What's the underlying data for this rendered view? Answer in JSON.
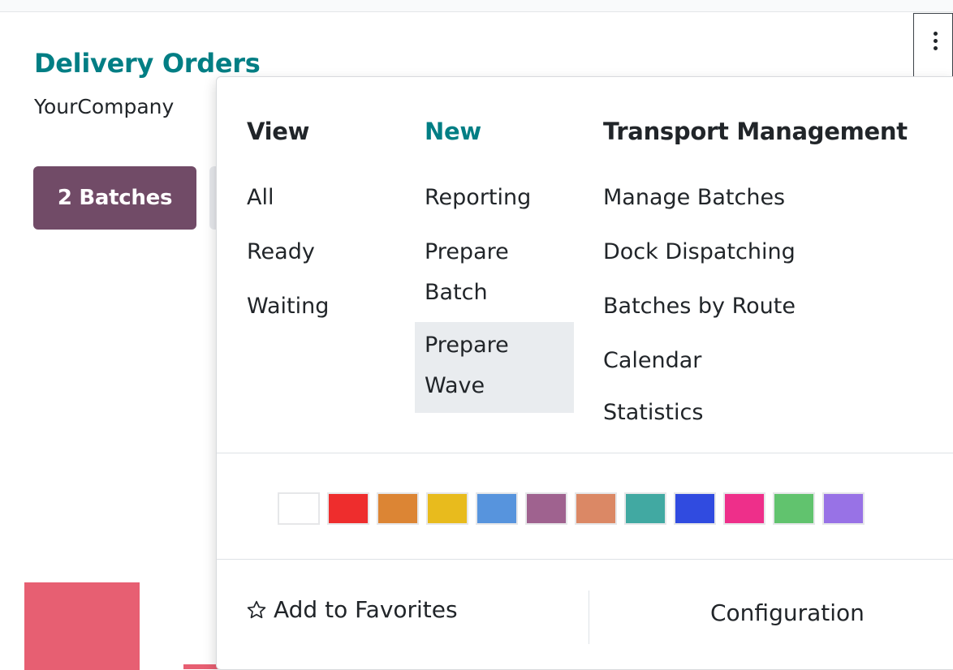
{
  "card": {
    "title": "Delivery Orders",
    "company": "YourCompany",
    "batches_button": "2 Batches",
    "graph_color": "#e75f72"
  },
  "kebab": {
    "icon": "vertical-ellipsis-icon"
  },
  "dropdown": {
    "view": {
      "header": "View",
      "items": [
        "All",
        "Ready",
        "Waiting"
      ]
    },
    "new": {
      "header": "New",
      "items": [
        "Reporting",
        "Prepare Batch",
        "Prepare Wave"
      ],
      "active_item": "Prepare Wave"
    },
    "transport": {
      "header": "Transport Management",
      "items": [
        "Manage Batches",
        "Dock Dispatching",
        "Batches by Route",
        "Calendar",
        "Statistics"
      ]
    },
    "colors": [
      "#ffffff",
      "#ee2d2d",
      "#dc8534",
      "#e8bb1d",
      "#5794dd",
      "#9f628f",
      "#db8865",
      "#41a9a2",
      "#304be0",
      "#ee2f8a",
      "#61c36e",
      "#9872e6"
    ],
    "favorites_label": "Add to Favorites",
    "favorites_icon": "star-outline-icon",
    "configuration_label": "Configuration"
  }
}
